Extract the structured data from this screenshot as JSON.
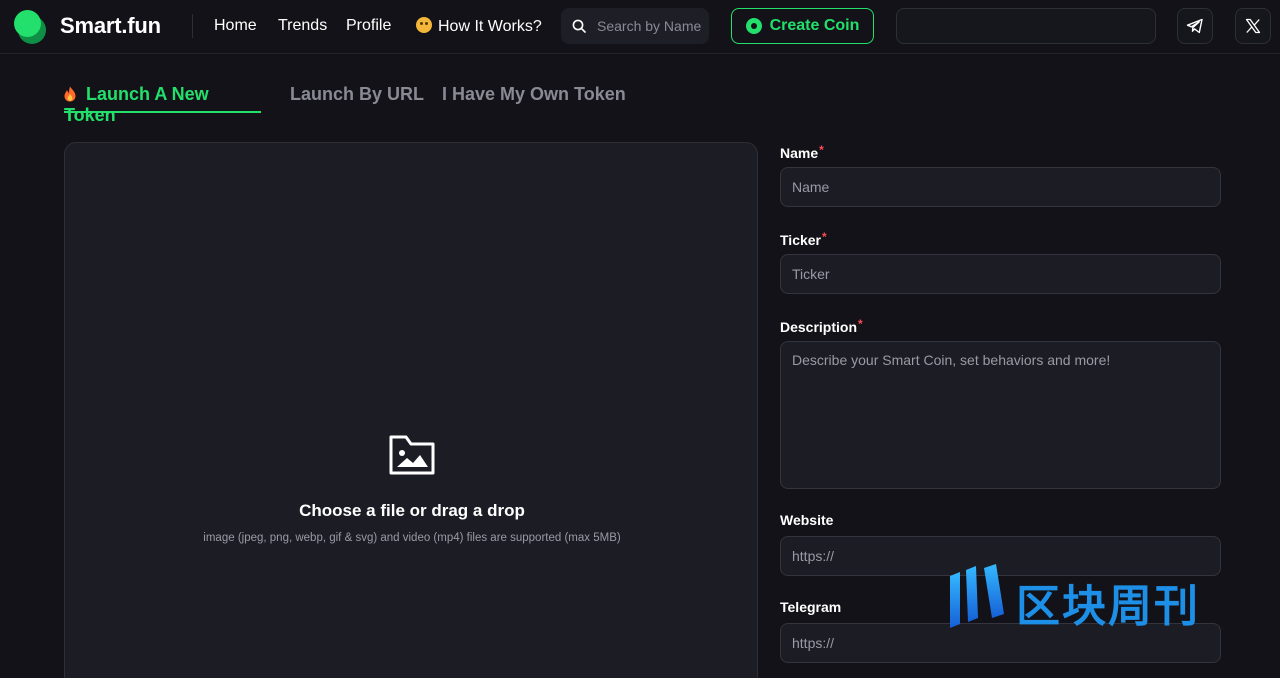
{
  "header": {
    "brand": "Smart.fun",
    "nav": [
      {
        "label": "Home"
      },
      {
        "label": "Trends"
      },
      {
        "label": "Profile"
      },
      {
        "label": "How It Works?"
      }
    ],
    "search": {
      "placeholder": "Search by Name",
      "value": ""
    },
    "create_button": "Create Coin",
    "icons": [
      "telegram-icon",
      "x-icon"
    ]
  },
  "tabs": [
    {
      "label": "Launch A New Token",
      "active": true
    },
    {
      "label": "Launch By URL",
      "active": false
    },
    {
      "label": "I Have My Own Token",
      "active": false
    }
  ],
  "upload": {
    "title": "Choose a file or drag a drop",
    "subtitle": "image (jpeg, png, webp, gif & svg) and video (mp4) files are supported (max 5MB)"
  },
  "form": {
    "name": {
      "label": "Name",
      "required_mark": "*",
      "placeholder": "Name"
    },
    "ticker": {
      "label": "Ticker",
      "required_mark": "*",
      "placeholder": "Ticker"
    },
    "description": {
      "label": "Description",
      "required_mark": "*",
      "placeholder": "Describe your Smart Coin, set behaviors and more!"
    },
    "website": {
      "label": "Website",
      "placeholder": "https://"
    },
    "telegram": {
      "label": "Telegram",
      "placeholder": "https://"
    }
  },
  "watermark": {
    "text": "区块周刊"
  },
  "colors": {
    "accent": "#22e06b",
    "background": "#121218",
    "panel": "#1c1c24",
    "required": "#ff4b55",
    "watermark": "#1d8fe6"
  }
}
